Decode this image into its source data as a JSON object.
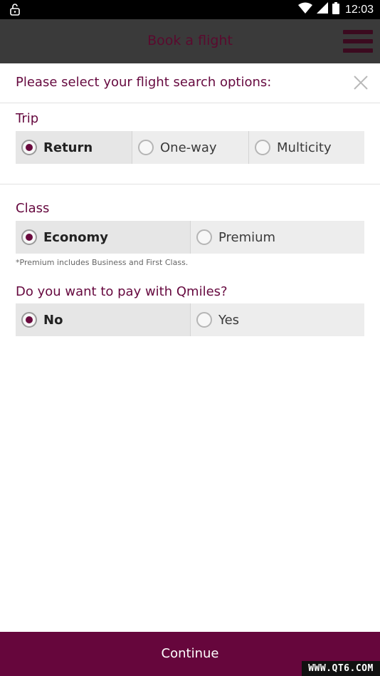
{
  "status_bar": {
    "time": "12:03",
    "left_icon": "notification-icon",
    "right_icons": [
      "wifi-icon",
      "signal-icon",
      "battery-icon"
    ]
  },
  "header": {
    "title": "Book a flight",
    "menu_icon": "hamburger-menu-icon"
  },
  "panel": {
    "title": "Please select your flight search options:",
    "close_icon": "close-icon"
  },
  "trip": {
    "label": "Trip",
    "options": [
      {
        "label": "Return",
        "selected": true
      },
      {
        "label": "One-way",
        "selected": false
      },
      {
        "label": "Multicity",
        "selected": false
      }
    ]
  },
  "class_section": {
    "label": "Class",
    "options": [
      {
        "label": "Economy",
        "selected": true
      },
      {
        "label": "Premium",
        "selected": false
      }
    ],
    "note": "*Premium includes Business and First Class."
  },
  "qmiles": {
    "label": "Do you want to pay with Qmiles?",
    "options": [
      {
        "label": "No",
        "selected": true
      },
      {
        "label": "Yes",
        "selected": false
      }
    ]
  },
  "footer": {
    "continue_label": "Continue",
    "watermark": "WWW.QT6.COM"
  },
  "colors": {
    "brand": "#66063c",
    "header_bg": "#3a3a3a",
    "option_bg": "#ededed"
  }
}
